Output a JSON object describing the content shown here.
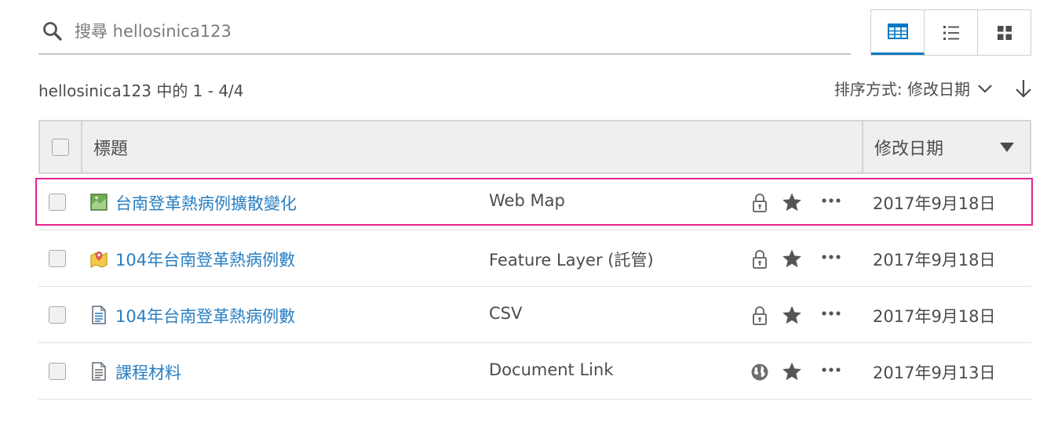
{
  "search": {
    "placeholder": "搜尋 hellosinica123",
    "value": ""
  },
  "view_toggle": {
    "active": "table",
    "icons": [
      "table-view-icon",
      "list-view-icon",
      "grid-view-icon"
    ]
  },
  "summary": "hellosinica123 中的 1 - 4/4",
  "sort": {
    "label": "排序方式: 修改日期"
  },
  "table": {
    "columns": {
      "title": "標題",
      "date": "修改日期"
    },
    "rows": [
      {
        "title": "台南登革熱病例擴散變化",
        "type": "Web Map",
        "date": "2017年9月18日",
        "type_icon": "web-map-icon",
        "share_icon": "lock-icon",
        "highlighted": true
      },
      {
        "title": "104年台南登革熱病例數",
        "type": "Feature Layer (託管)",
        "date": "2017年9月18日",
        "type_icon": "feature-layer-icon",
        "share_icon": "lock-icon",
        "highlighted": false
      },
      {
        "title": "104年台南登革熱病例數",
        "type": "CSV",
        "date": "2017年9月18日",
        "type_icon": "csv-file-icon",
        "share_icon": "lock-icon",
        "highlighted": false
      },
      {
        "title": "課程材料",
        "type": "Document Link",
        "date": "2017年9月13日",
        "type_icon": "document-link-icon",
        "share_icon": "globe-icon",
        "highlighted": false
      }
    ]
  },
  "colors": {
    "accent": "#0079c1",
    "link": "#2a7fc1",
    "highlight": "#e4238e",
    "text": "#4c4c4c"
  }
}
